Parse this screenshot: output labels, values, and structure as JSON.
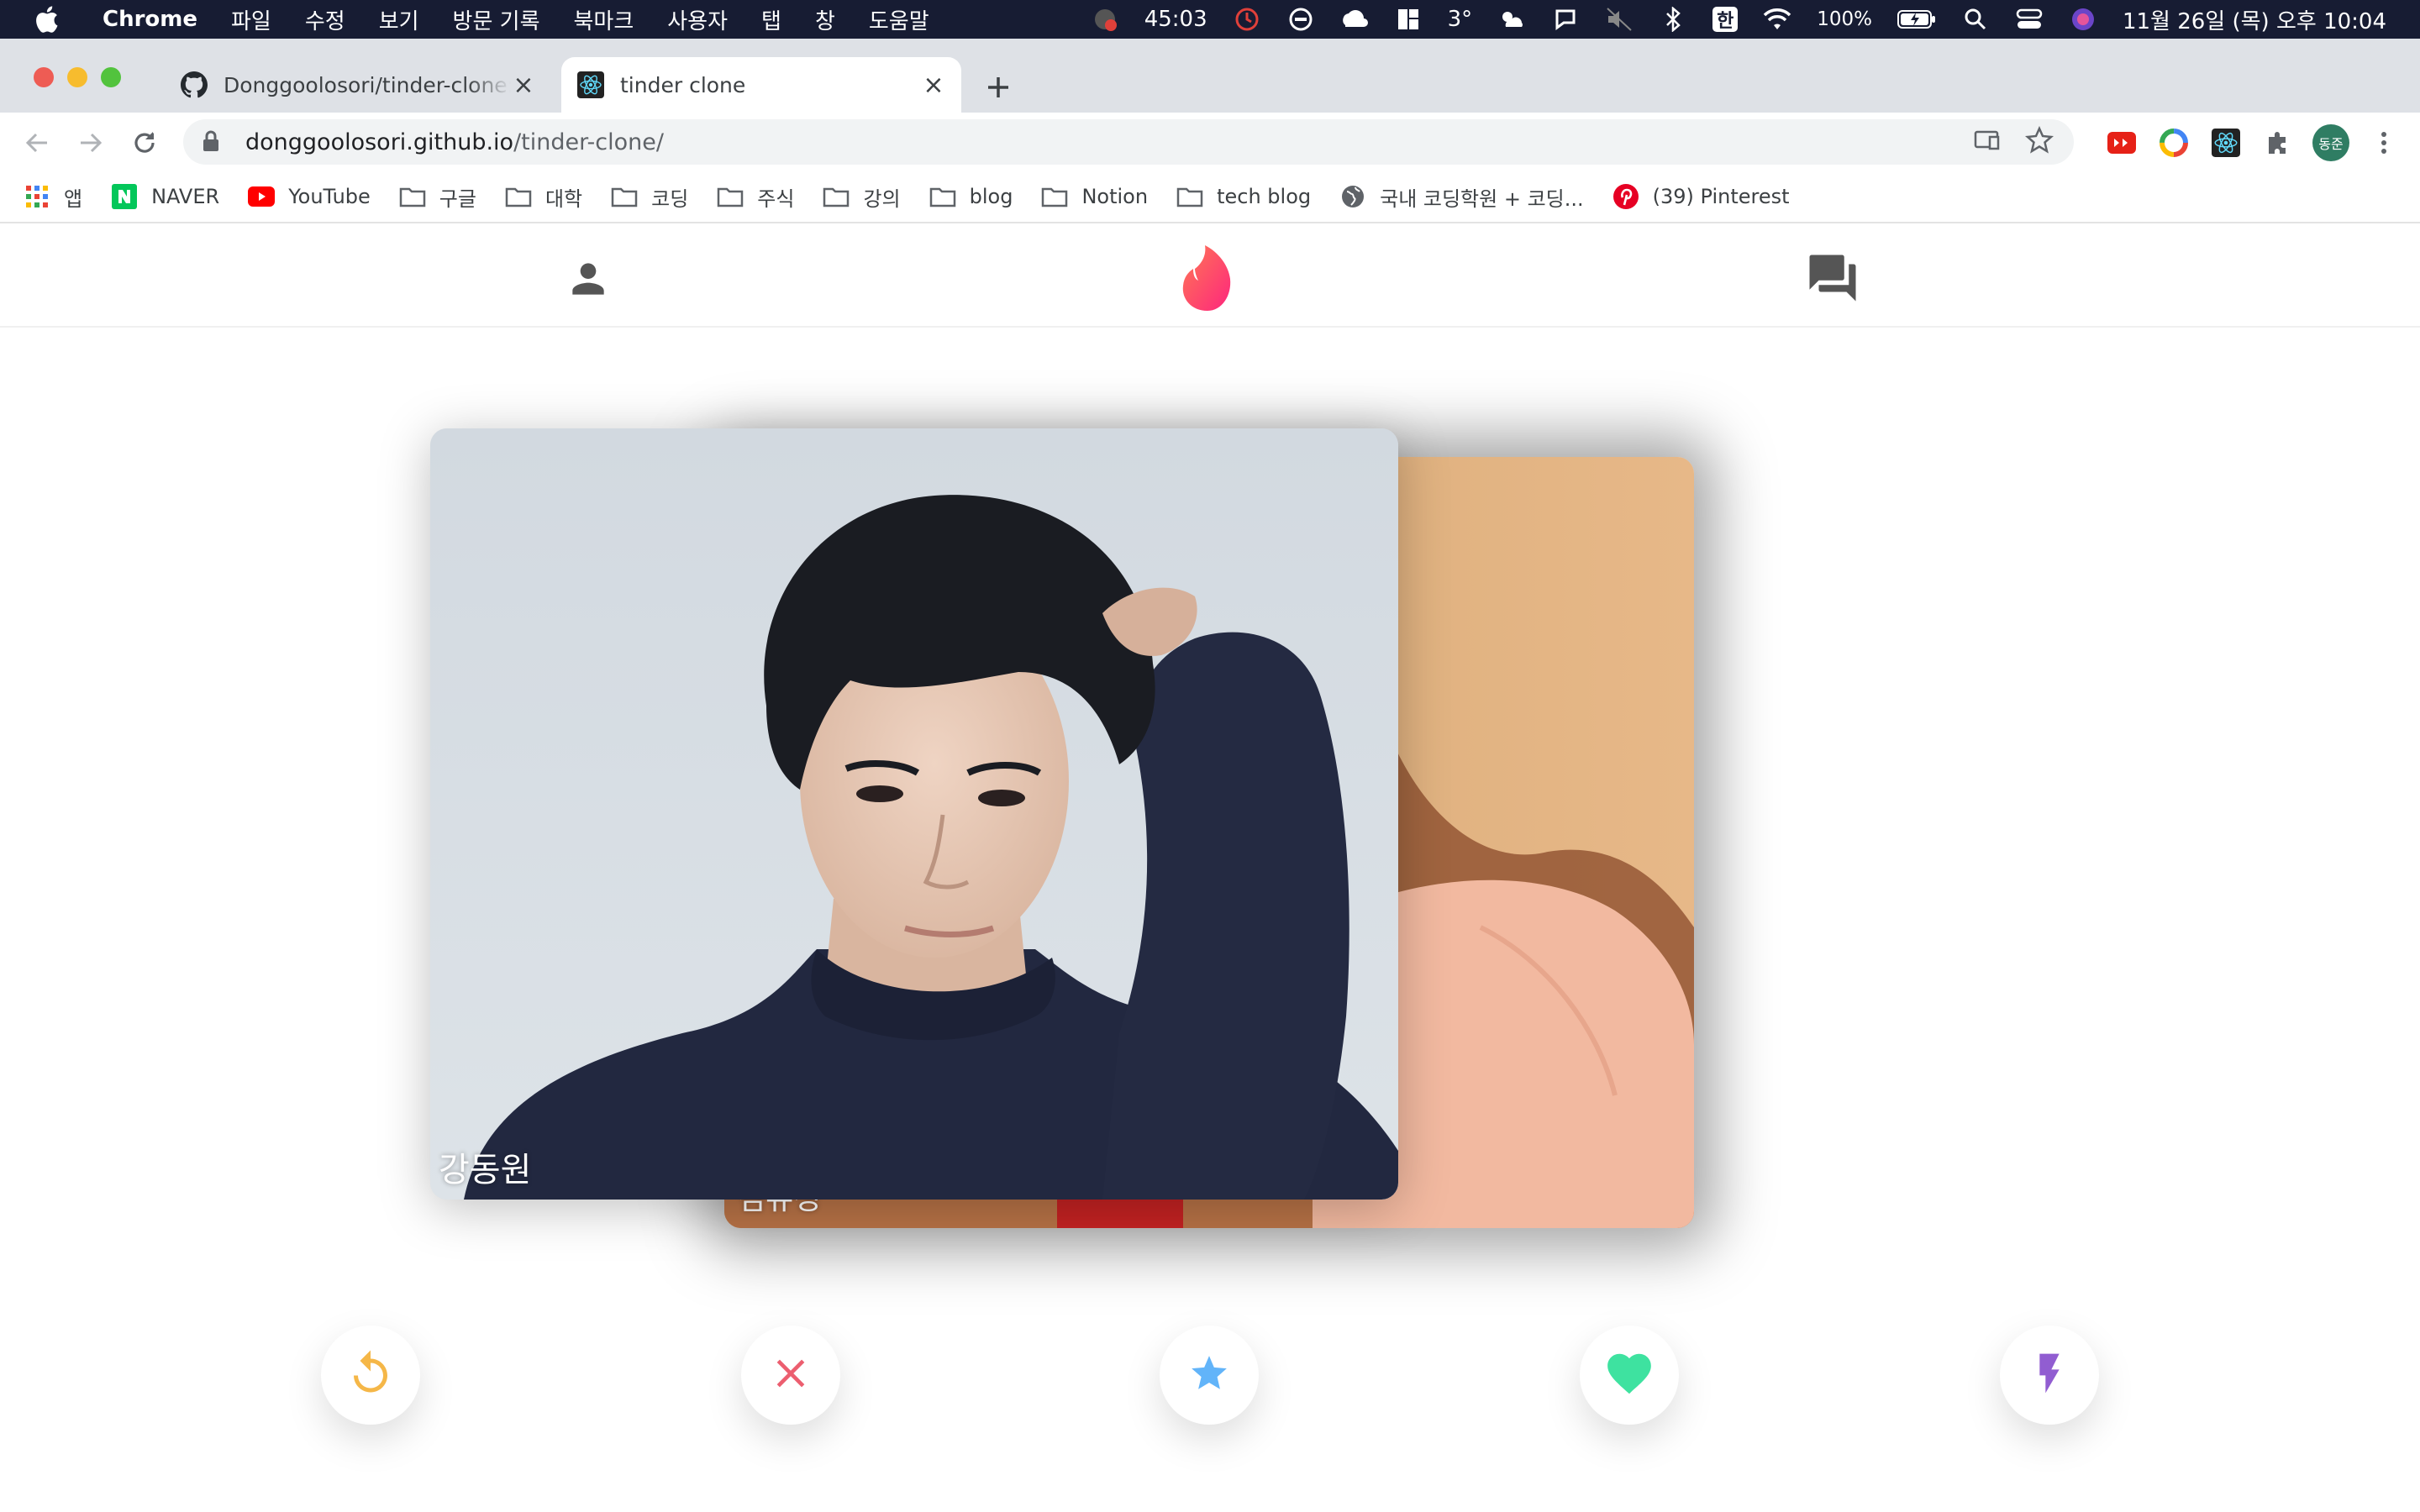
{
  "menubar": {
    "app_name": "Chrome",
    "menus": [
      "파일",
      "수정",
      "보기",
      "방문 기록",
      "북마크",
      "사용자",
      "탭",
      "창",
      "도움말"
    ],
    "timer": "45:03",
    "temperature": "3°",
    "input_mode": "한",
    "battery": "100%",
    "datetime": "11월 26일 (목) 오후 10:04"
  },
  "tabs": [
    {
      "title": "Donggoolosori/tinder-clone: tinder",
      "icon": "github-icon"
    },
    {
      "title": "tinder clone",
      "icon": "react-icon"
    }
  ],
  "toolbar": {
    "url_host": "donggoolosori.github.io",
    "url_path": "/tinder-clone/",
    "avatar_text": "동준"
  },
  "bookmarks": [
    {
      "label": "앱",
      "icon": "apps-grid-icon"
    },
    {
      "label": "NAVER",
      "icon": "naver-icon"
    },
    {
      "label": "YouTube",
      "icon": "youtube-icon"
    },
    {
      "label": "구글",
      "icon": "folder-icon"
    },
    {
      "label": "대학",
      "icon": "folder-icon"
    },
    {
      "label": "코딩",
      "icon": "folder-icon"
    },
    {
      "label": "주식",
      "icon": "folder-icon"
    },
    {
      "label": "강의",
      "icon": "folder-icon"
    },
    {
      "label": "blog",
      "icon": "folder-icon"
    },
    {
      "label": "Notion",
      "icon": "folder-icon"
    },
    {
      "label": "tech blog",
      "icon": "folder-icon"
    },
    {
      "label": "국내 코딩학원 + 코딩...",
      "icon": "globe-icon"
    },
    {
      "label": "(39) Pinterest",
      "icon": "pinterest-icon"
    }
  ],
  "app": {
    "header_icons": [
      "person-icon",
      "tinder-flame-icon",
      "forum-icon"
    ],
    "cards": [
      {
        "name": "김유정",
        "layer": "back"
      },
      {
        "name": "강동원",
        "layer": "front"
      }
    ],
    "actions": [
      {
        "name": "replay-icon",
        "color": "#f5b748"
      },
      {
        "name": "close-icon",
        "color": "#ec5e6f"
      },
      {
        "name": "star-icon",
        "color": "#62b4f9"
      },
      {
        "name": "heart-icon",
        "color": "#3ee2a0"
      },
      {
        "name": "flash-icon",
        "color": "#915dd1"
      }
    ]
  }
}
